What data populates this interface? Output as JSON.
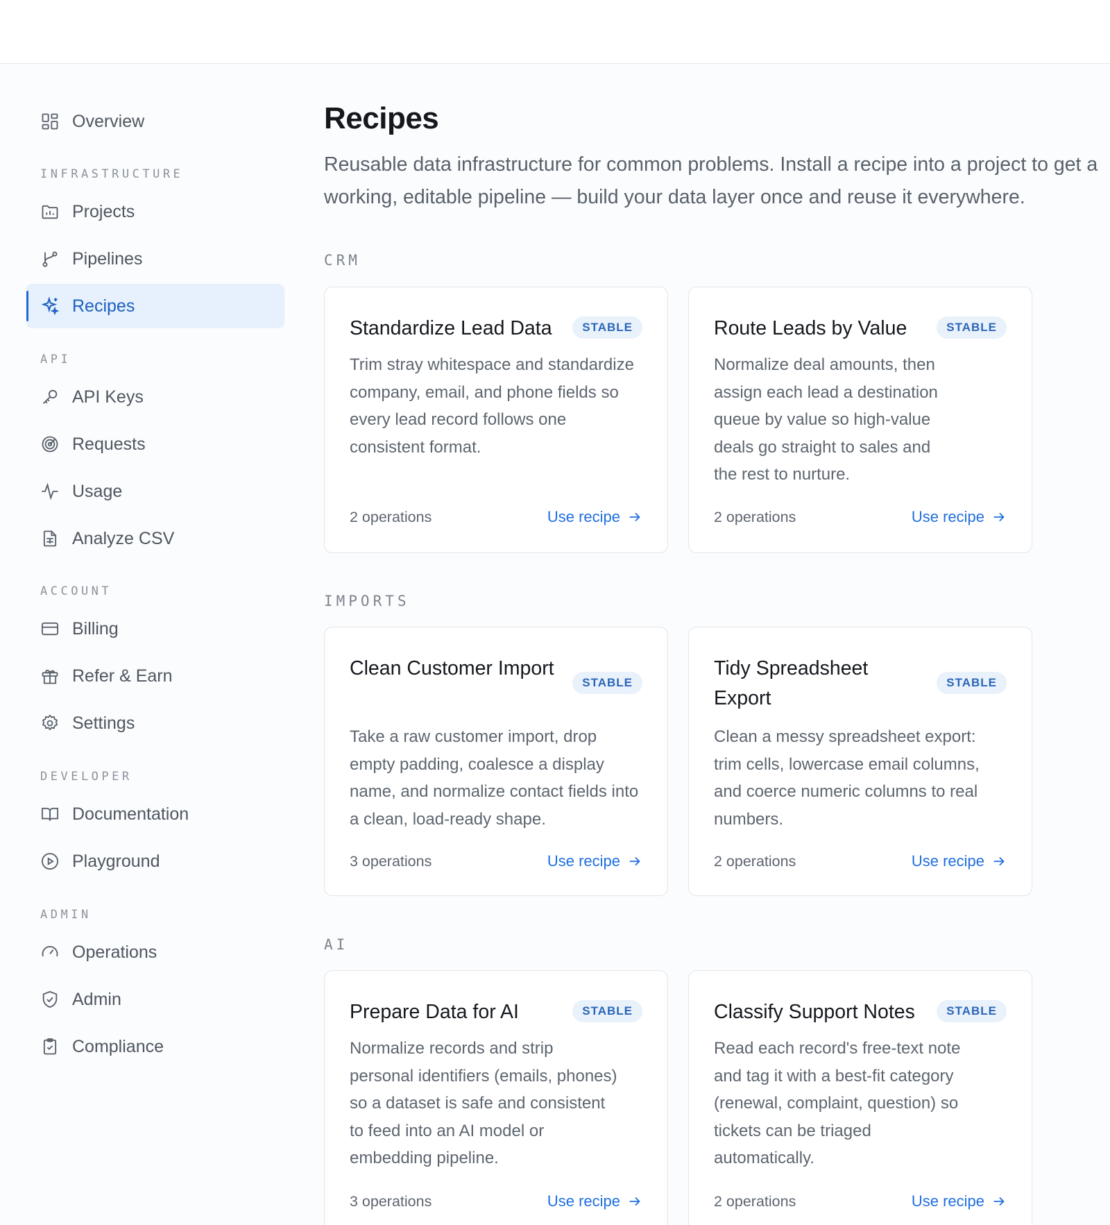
{
  "sidebar": {
    "items": [
      {
        "label": "Overview"
      },
      {
        "label": "Projects"
      },
      {
        "label": "Pipelines"
      },
      {
        "label": "Recipes"
      },
      {
        "label": "API Keys"
      },
      {
        "label": "Requests"
      },
      {
        "label": "Usage"
      },
      {
        "label": "Analyze CSV"
      },
      {
        "label": "Billing"
      },
      {
        "label": "Refer & Earn"
      },
      {
        "label": "Settings"
      },
      {
        "label": "Documentation"
      },
      {
        "label": "Playground"
      },
      {
        "label": "Operations"
      },
      {
        "label": "Admin"
      },
      {
        "label": "Compliance"
      }
    ],
    "sections": [
      "INFRASTRUCTURE",
      "API",
      "ACCOUNT",
      "DEVELOPER",
      "ADMIN"
    ],
    "active": "Recipes"
  },
  "main": {
    "title": "Recipes",
    "description": "Reusable data infrastructure for common problems. Install a recipe into a project to get a working, editable pipeline — build your data layer once and reuse it everywhere.",
    "sections": [
      {
        "label": "CRM",
        "cards": [
          {
            "title": "Standardize Lead Data",
            "badge": "STABLE",
            "description": "Trim stray whitespace and standardize company, email, and phone fields so every lead record follows one consistent format.",
            "operations": "2 operations",
            "cta": "Use recipe"
          },
          {
            "title": "Route Leads by Value",
            "badge": "STABLE",
            "description": "Normalize deal amounts, then assign each lead a destination queue by value so high-value deals go straight to sales and the rest to nurture.",
            "operations": "2 operations",
            "cta": "Use recipe"
          }
        ]
      },
      {
        "label": "IMPORTS",
        "cards": [
          {
            "title": "Clean Customer Import",
            "badge": "STABLE",
            "description": "Take a raw customer import, drop empty padding, coalesce a display name, and normalize contact fields into a clean, load-ready shape.",
            "operations": "3 operations",
            "cta": "Use recipe"
          },
          {
            "title": "Tidy Spreadsheet Export",
            "badge": "STABLE",
            "description": "Clean a messy spreadsheet export: trim cells, lowercase email columns, and coerce numeric columns to real numbers.",
            "operations": "2 operations",
            "cta": "Use recipe"
          }
        ]
      },
      {
        "label": "AI",
        "cards": [
          {
            "title": "Prepare Data for AI",
            "badge": "STABLE",
            "description": "Normalize records and strip personal identifiers (emails, phones) so a dataset is safe and consistent to feed into an AI model or embedding pipeline.",
            "operations": "3 operations",
            "cta": "Use recipe"
          },
          {
            "title": "Classify Support Notes",
            "badge": "STABLE",
            "description": "Read each record's free-text note and tag it with a best-fit category (renewal, complaint, question) so tickets can be triaged automatically.",
            "operations": "2 operations",
            "cta": "Use recipe"
          }
        ]
      }
    ]
  },
  "colors": {
    "accent": "#1f6fe0",
    "active_bg": "#e6f1fd",
    "badge_bg": "#e9f1fb"
  }
}
